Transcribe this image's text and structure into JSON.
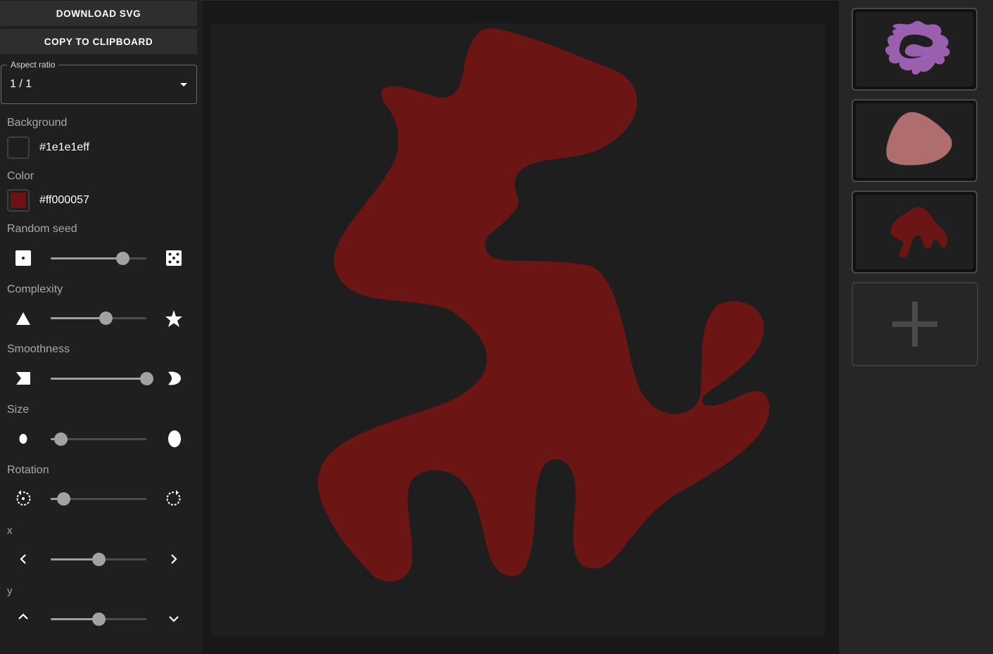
{
  "toolbar": {
    "download_label": "DOWNLOAD SVG",
    "copy_label": "COPY TO CLIPBOARD"
  },
  "aspect_ratio": {
    "legend": "Aspect ratio",
    "value": "1 / 1"
  },
  "background": {
    "label": "Background",
    "value": "#1e1e1eff",
    "swatch_color": "#1e1e1e"
  },
  "color": {
    "label": "Color",
    "value": "#ff000057",
    "swatch_color": "#6e1313"
  },
  "sliders": [
    {
      "label": "Random seed",
      "left_icon": "die-one-icon",
      "right_icon": "die-five-icon",
      "value": 0.75
    },
    {
      "label": "Complexity",
      "left_icon": "triangle-icon",
      "right_icon": "star-icon",
      "value": 0.57
    },
    {
      "label": "Smoothness",
      "left_icon": "jagged-shape-icon",
      "right_icon": "smooth-shape-icon",
      "value": 1.0
    },
    {
      "label": "Size",
      "left_icon": "small-blob-icon",
      "right_icon": "large-blob-icon",
      "value": 0.1
    },
    {
      "label": "Rotation",
      "left_icon": "rotate-left-icon",
      "right_icon": "rotate-right-icon",
      "value": 0.13
    },
    {
      "label": "x",
      "left_icon": "chevron-left-icon",
      "right_icon": "chevron-right-icon",
      "value": 0.5
    },
    {
      "label": "y",
      "left_icon": "chevron-up-icon",
      "right_icon": "chevron-down-icon",
      "value": 0.5
    }
  ],
  "blob": {
    "fill": "#6b1515"
  },
  "saved_blobs": [
    {
      "name": "saved-blob-purple",
      "fill": "#9a5fae"
    },
    {
      "name": "saved-blob-pink",
      "fill": "#b06d6d"
    },
    {
      "name": "saved-blob-red",
      "fill": "#6b1515"
    }
  ],
  "add_card": {
    "icon": "plus-icon"
  }
}
